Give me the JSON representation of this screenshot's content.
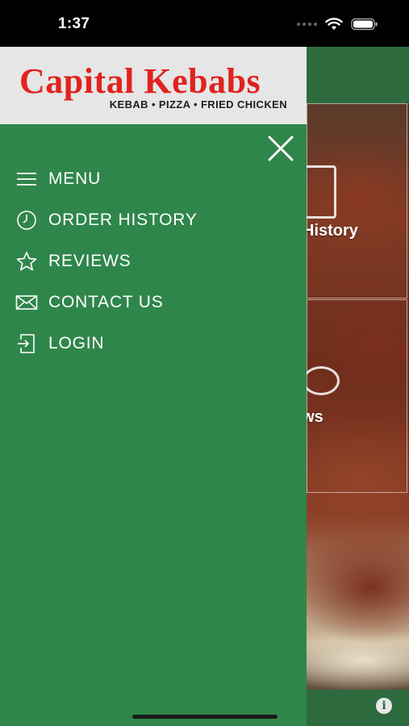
{
  "status_bar": {
    "time": "1:37"
  },
  "background_screen": {
    "tiles": [
      {
        "label": "History",
        "icon": "document-icon"
      },
      {
        "label": "ews",
        "icon": "chat-bubble-icon"
      }
    ],
    "info_icon": "i"
  },
  "drawer": {
    "logo": {
      "title": "Capital Kebabs",
      "tagline": "KEBAB • PIZZA • FRIED CHICKEN"
    },
    "close_icon": "close-icon",
    "items": [
      {
        "label": "MENU",
        "icon": "hamburger-icon"
      },
      {
        "label": "ORDER HISTORY",
        "icon": "clock-icon"
      },
      {
        "label": "REVIEWS",
        "icon": "star-icon"
      },
      {
        "label": "CONTACT US",
        "icon": "envelope-icon"
      },
      {
        "label": "LOGIN",
        "icon": "login-icon"
      }
    ]
  },
  "colors": {
    "drawer_green": "#2f864b",
    "header_green": "#2d6b3f",
    "logo_red": "#e0231f",
    "header_bg": "#e6e6e6"
  }
}
